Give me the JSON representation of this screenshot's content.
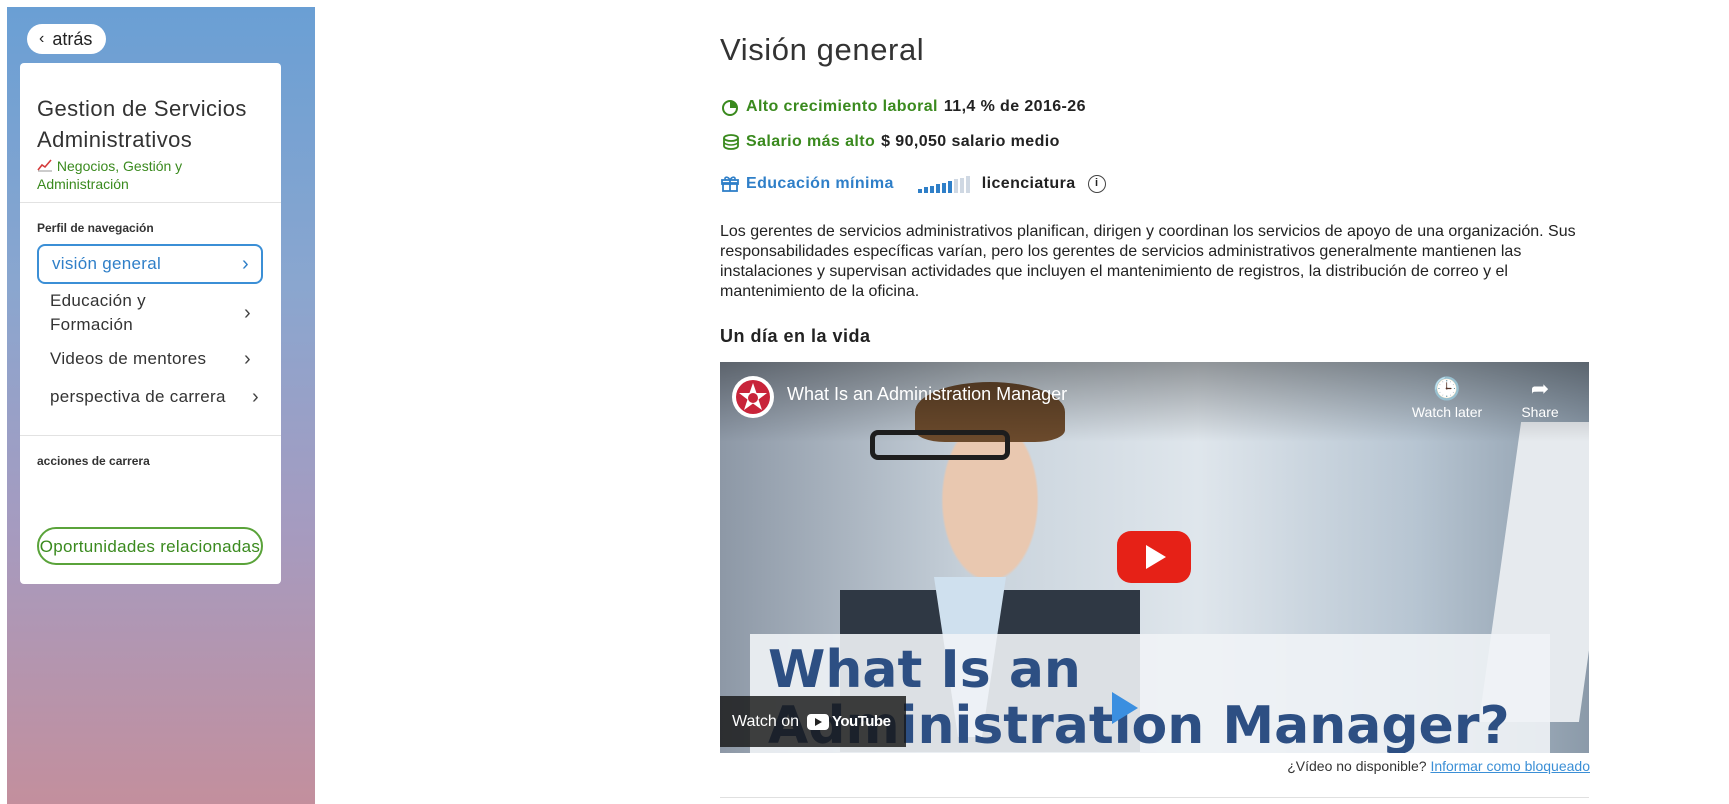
{
  "sidebar": {
    "back_label": "atrás",
    "career_title": "Gestion de Servicios Administrativos",
    "career_category": "Negocios, Gestión y Administración",
    "nav_heading": "Perfil de navegación",
    "nav_items": [
      {
        "label": "visión general",
        "active": true
      },
      {
        "label": "Educación y Formación",
        "active": false
      },
      {
        "label": "Videos de mentores",
        "active": false
      },
      {
        "label": "perspectiva de carrera",
        "active": false
      }
    ],
    "actions_heading": "acciones de carrera",
    "opportunities_label": "Oportunidades relacionadas"
  },
  "main": {
    "title": "Visión general",
    "growth": {
      "label": "Alto crecimiento laboral",
      "value": "11,4 % de 2016-26"
    },
    "salary": {
      "label": "Salario más alto",
      "value": "$ 90,050 salario medio"
    },
    "education": {
      "label": "Educación mínima",
      "value": "licenciatura",
      "level": 6,
      "max_level": 9
    },
    "description": "Los gerentes de servicios administrativos planifican, dirigen y coordinan los servicios de apoyo de una organización. Sus responsabilidades específicas varían, pero los gerentes de servicios administrativos generalmente mantienen las instalaciones y supervisan actividades que incluyen el mantenimiento de registros, la distribución de correo y el mantenimiento de la oficina.",
    "day_in_life_heading": "Un día en la vida",
    "video": {
      "title": "What Is an Administration Manager",
      "watch_later": "Watch later",
      "share": "Share",
      "banner_line1": "What Is an",
      "banner_line2": "Administration Manager?",
      "watch_on": "Watch on",
      "youtube": "YouTube"
    },
    "unavailable_text": "¿Vídeo no disponible?",
    "report_link": "Informar como bloqueado"
  },
  "colors": {
    "green": "#3a8a1e",
    "blue": "#2f7fc8",
    "youtube_red": "#e62117"
  }
}
